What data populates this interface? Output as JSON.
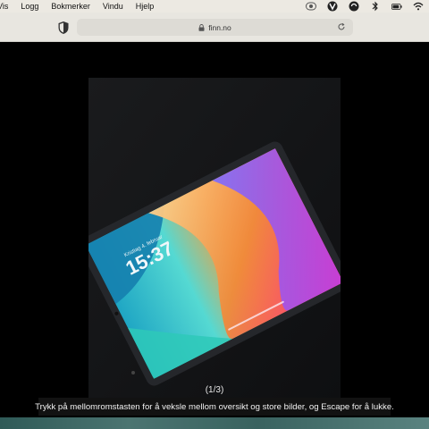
{
  "menubar": {
    "items": [
      "Vis",
      "Logg",
      "Bokmerker",
      "Vindu",
      "Hjelp"
    ],
    "status_icons": [
      "record-icon",
      "vpn-icon",
      "sync-icon",
      "bluetooth-icon",
      "battery-icon",
      "wifi-icon"
    ]
  },
  "toolbar": {
    "url": "finn.no",
    "privacy_icon": "shield-icon",
    "reload_icon": "reload-icon"
  },
  "lightbox": {
    "counter": "(1/3)",
    "help_text": "Trykk på mellomromstasten for å veksle mellom oversikt og store bilder, og Escape for å lukke.",
    "image": {
      "description_icon": "ipad-photo",
      "screen_date": "Kristiag 4. februar",
      "screen_time": "15:37"
    }
  },
  "colors": {
    "menubar_bg": "#ece9e2",
    "toolbar_bg": "#e8e6e0",
    "viewer_bg": "#000000",
    "help_bg": "#121212"
  }
}
